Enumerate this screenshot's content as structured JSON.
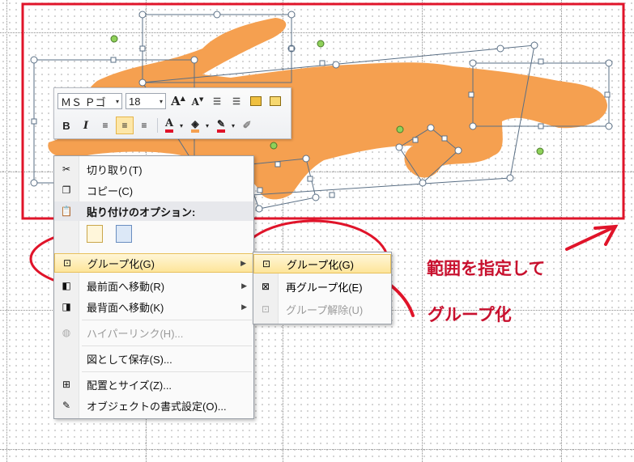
{
  "toolbar": {
    "font_name": "ＭＳ Ｐゴ",
    "font_size": "18"
  },
  "context_menu": {
    "items": [
      {
        "label": "切り取り(T)",
        "icon": "scissors-icon"
      },
      {
        "label": "コピー(C)",
        "icon": "copy-icon"
      },
      {
        "label": "貼り付けのオプション:",
        "icon": "clipboard-icon"
      },
      {
        "label": "グループ化(G)",
        "icon": "group-icon"
      },
      {
        "label": "最前面へ移動(R)",
        "icon": "bring-to-front-icon"
      },
      {
        "label": "最背面へ移動(K)",
        "icon": "send-to-back-icon"
      },
      {
        "label": "ハイパーリンク(H)...",
        "icon": "globe-icon"
      },
      {
        "label": "図として保存(S)...",
        "icon": ""
      },
      {
        "label": "配置とサイズ(Z)...",
        "icon": "size-position-icon"
      },
      {
        "label": "オブジェクトの書式設定(O)...",
        "icon": "format-object-icon"
      }
    ]
  },
  "submenu": {
    "items": [
      {
        "label": "グループ化(G)",
        "icon": "group-icon"
      },
      {
        "label": "再グループ化(E)",
        "icon": "regroup-icon"
      },
      {
        "label": "グループ解除(U)",
        "icon": "ungroup-icon"
      }
    ]
  },
  "annotations": {
    "select_range": "範囲を指定して",
    "group": "グループ化"
  },
  "colors": {
    "accent_red": "#e0142a",
    "shape_orange": "#f5a050",
    "handle_green": "#8fd15a"
  }
}
